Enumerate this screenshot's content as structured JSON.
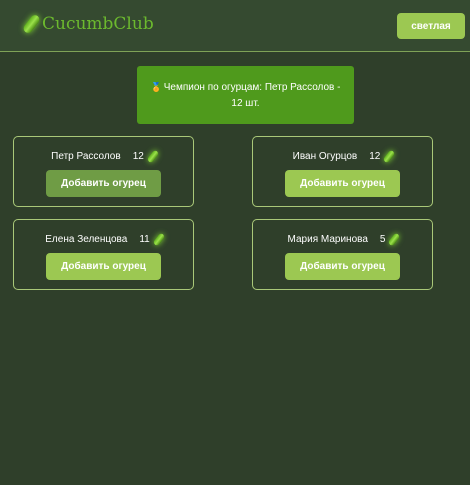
{
  "app": {
    "title": "CucumbClub"
  },
  "header": {
    "theme_button_label": "светлая"
  },
  "champion": {
    "text": "Чемпион по огурцам: Петр Рассолов - 12 шт."
  },
  "players": [
    {
      "name": "Петр Рассолов",
      "count": "12",
      "button_label": "Добавить огурец"
    },
    {
      "name": "Иван Огурцов",
      "count": "12",
      "button_label": "Добавить огурец"
    },
    {
      "name": "Елена Зеленцова",
      "count": "11",
      "button_label": "Добавить огурец"
    },
    {
      "name": "Мария Маринова",
      "count": "5",
      "button_label": "Добавить огурец"
    }
  ],
  "icons": {
    "logo": "cucumber-icon",
    "card": "cucumber-icon",
    "champion": "medal-icon"
  },
  "colors": {
    "background": "#2f3f2a",
    "header": "#354a30",
    "accent": "#9cc852",
    "accent_pressed": "#6f9c45",
    "champion_banner": "#4f9a1c",
    "logo_text": "#6cb92e"
  }
}
